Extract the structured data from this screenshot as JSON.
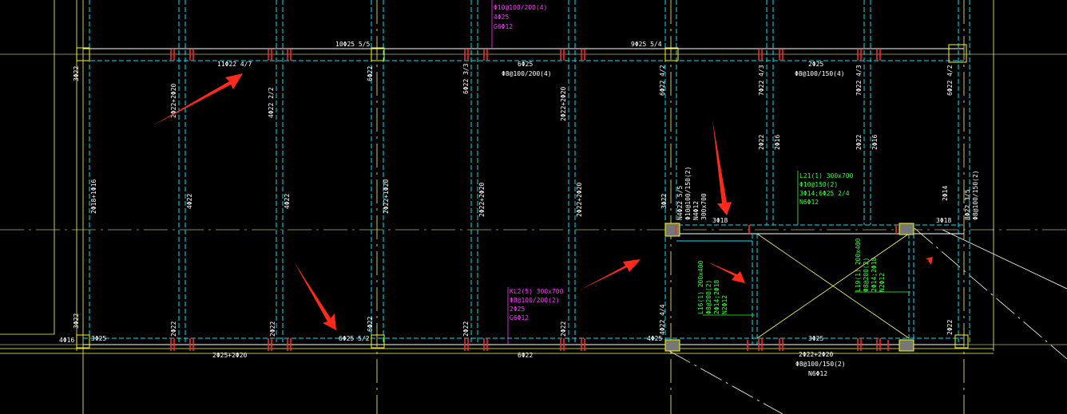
{
  "colors": {
    "background": "#000000",
    "beam_line": "#ffffff",
    "beam_hidden": "#00e5ff",
    "axis": "#ffff66",
    "column": "#ffff00",
    "rebar_mark": "#ff2a2a",
    "text_white": "#ffffff",
    "text_magenta": "#ff33ff",
    "text_green": "#33ff33",
    "arrow": "#ff2a1a"
  },
  "top_labels": [
    {
      "id": "t1",
      "text": "10Φ25 5/5"
    },
    {
      "id": "t2",
      "text": "9Φ25 5/4"
    },
    {
      "id": "t3",
      "text": "11Φ22 4/7"
    },
    {
      "id": "t4",
      "text": "6Φ25"
    },
    {
      "id": "t5",
      "text": "Φ8@100/200(4)"
    },
    {
      "id": "t6",
      "text": "2Φ25"
    },
    {
      "id": "t7",
      "text": "Φ8@100/150(4)"
    }
  ],
  "magenta_top": [
    "Φ10@100/200(4)",
    "4Φ25",
    "G6Φ12"
  ],
  "magenta_kl": [
    "KL2(5) 300x700",
    "Φ8@100/200(2)",
    "2Φ25",
    "G6Φ12"
  ],
  "green_l21": [
    "L21(1) 300x700",
    "Φ10@150(2)",
    "3Φ14;6Φ25 2/4",
    "N6Φ12"
  ],
  "green_l16": [
    "L16(1) 200x400",
    "Φ8@200(2)",
    "2Φ14;2Φ18",
    "N2Φ12"
  ],
  "green_l19": [
    "L19(1) 200x400",
    "Φ8@200(2)",
    "2Φ14;2Φ18",
    "N2Φ12"
  ],
  "beam_l_vert": [
    "N4Φ22 5/5",
    "Φ10@100/150(2)",
    "N4Φ12",
    "300x700"
  ],
  "right_vert": [
    "8Φ22 3/5",
    "Φ8@100/150(2)"
  ],
  "vertical_labels": [
    {
      "id": "v1",
      "text": "3Φ22"
    },
    {
      "id": "v2",
      "text": "2Φ22+2Φ20"
    },
    {
      "id": "v3",
      "text": "4Φ22 2/2"
    },
    {
      "id": "v4",
      "text": "6Φ22"
    },
    {
      "id": "v5",
      "text": "6Φ22 3/3"
    },
    {
      "id": "v6",
      "text": "2Φ22+2Φ20"
    },
    {
      "id": "v7",
      "text": "6Φ22 4/2"
    },
    {
      "id": "v8",
      "text": "7Φ22 4/3"
    },
    {
      "id": "v9",
      "text": "7Φ22 4/3"
    },
    {
      "id": "v10",
      "text": "6Φ22 4/2"
    },
    {
      "id": "v11",
      "text": "2Φ18+1Φ16"
    },
    {
      "id": "v12",
      "text": "4Φ22"
    },
    {
      "id": "v13",
      "text": "4Φ22"
    },
    {
      "id": "v14",
      "text": "2Φ22+1Φ20"
    },
    {
      "id": "v15",
      "text": "2Φ22+2Φ20"
    },
    {
      "id": "v16",
      "text": "2Φ22+2Φ20"
    },
    {
      "id": "v17",
      "text": "3Φ22"
    },
    {
      "id": "v18",
      "text": "2Φ22"
    },
    {
      "id": "v19",
      "text": "2Φ16"
    },
    {
      "id": "v20",
      "text": "2Φ22"
    },
    {
      "id": "v21",
      "text": "2Φ16"
    },
    {
      "id": "v22",
      "text": "2Φ14"
    },
    {
      "id": "v23",
      "text": "3Φ22"
    },
    {
      "id": "v24",
      "text": "2Φ22"
    },
    {
      "id": "v25",
      "text": "2Φ22"
    },
    {
      "id": "v26",
      "text": "6Φ22"
    },
    {
      "id": "v27",
      "text": "2Φ22"
    },
    {
      "id": "v28",
      "text": "2Φ22"
    },
    {
      "id": "v29",
      "text": "4Φ22 4/4"
    },
    {
      "id": "v30",
      "text": "2Φ22"
    }
  ],
  "mid_labels": [
    {
      "id": "m1",
      "text": "3Φ18"
    },
    {
      "id": "m2",
      "text": "3Φ18"
    }
  ],
  "bottom_labels": [
    {
      "id": "b1",
      "text": "4Φ16"
    },
    {
      "id": "b2",
      "text": "3Φ25"
    },
    {
      "id": "b3",
      "text": "6Φ25 5/2"
    },
    {
      "id": "b4",
      "text": "4Φ25"
    },
    {
      "id": "b5",
      "text": "2Φ25+2Φ20"
    },
    {
      "id": "b6",
      "text": "6Φ22"
    },
    {
      "id": "b7",
      "text": "3Φ25"
    },
    {
      "id": "b8",
      "text": "2Φ22+2Φ20"
    },
    {
      "id": "b9",
      "text": "Φ8@100/150(2)"
    },
    {
      "id": "b10",
      "text": "N6Φ12"
    }
  ]
}
